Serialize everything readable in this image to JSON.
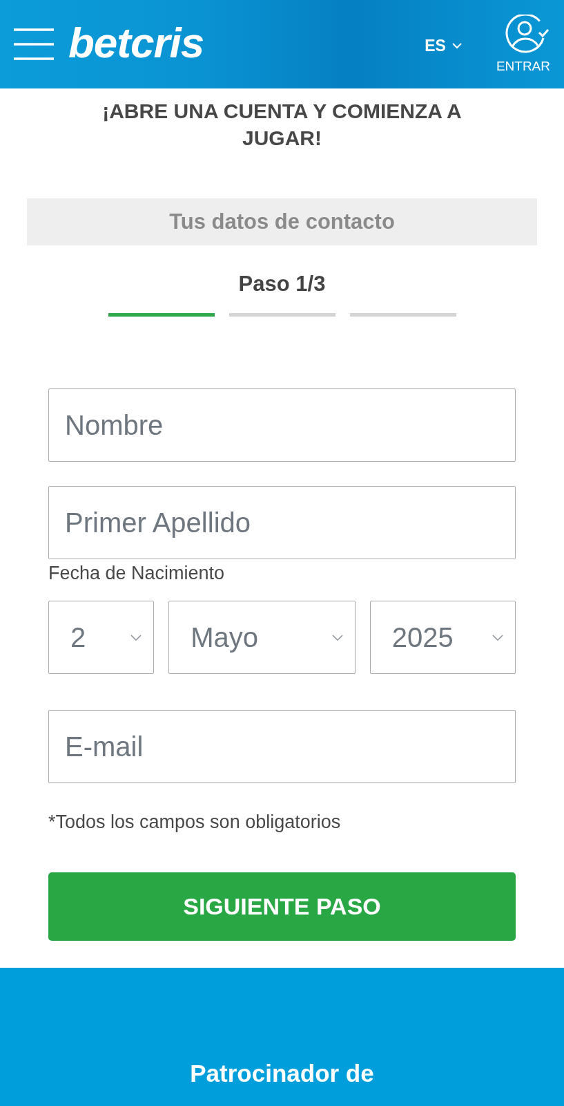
{
  "header": {
    "logo": "betcris",
    "language": "ES",
    "login_label": "ENTRAR"
  },
  "title": "¡ABRE UNA CUENTA Y COMIENZA A JUGAR!",
  "section_title": "Tus datos de contacto",
  "step": {
    "label": "Paso 1/3",
    "segments": [
      {
        "active": true
      },
      {
        "active": false
      },
      {
        "active": false
      }
    ]
  },
  "form": {
    "fields": [
      {
        "kind": "text",
        "placeholder": "Nombre"
      },
      {
        "kind": "text",
        "placeholder": "Primer Apellido"
      },
      {
        "kind": "date",
        "label": "Fecha de Nacimiento",
        "selects": [
          {
            "value": "2"
          },
          {
            "value": "Mayo"
          },
          {
            "value": "2025"
          }
        ]
      },
      {
        "kind": "text",
        "placeholder": "E-mail"
      }
    ],
    "note": "*Todos los campos son obligatorios",
    "submit_label": "SIGUIENTE PASO"
  },
  "footer": {
    "heading": "Patrocinador de"
  }
}
